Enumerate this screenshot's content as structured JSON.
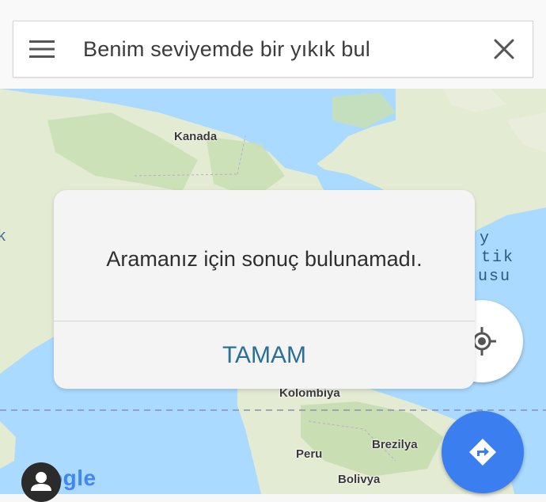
{
  "search": {
    "query": "Benim seviyemde bir yıkık bul"
  },
  "map": {
    "labels": {
      "canada": "Kanada",
      "colombia": "Kolombiya",
      "peru": "Peru",
      "brazil": "Brezilya",
      "bolivia": "Bolivya"
    },
    "partial_ocean_label": [
      "y",
      "tik",
      "usu"
    ],
    "left_edge_fragment": "k"
  },
  "dialog": {
    "message": "Aramanız için sonuç bulunamadı.",
    "ok_label": "TAMAM"
  },
  "branding": {
    "logo_visible": "ogle"
  },
  "icons": {
    "menu": "hamburger-icon",
    "close": "close-icon",
    "locate": "my-location-icon",
    "directions": "directions-icon",
    "avatar": "person-icon"
  },
  "colors": {
    "water": "#aadaff",
    "land": "#e6ecd6",
    "directions_button": "#3b7ef0",
    "dialog_action": "#2a6f9a"
  }
}
